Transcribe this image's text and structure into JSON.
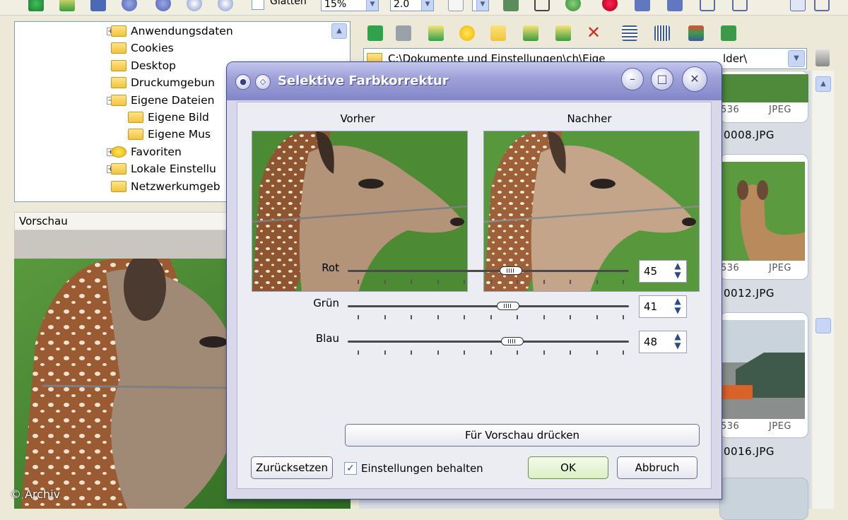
{
  "toolbar": {
    "smooth_label": "Glätten",
    "zoom_value": "15%",
    "gamma_value": "2.0"
  },
  "tree": {
    "items": [
      {
        "label": "Anwendungsdaten",
        "expander": "+"
      },
      {
        "label": "Cookies",
        "expander": ""
      },
      {
        "label": "Desktop",
        "expander": ""
      },
      {
        "label": "Druckumgebun",
        "expander": ""
      },
      {
        "label": "Eigene Dateien",
        "expander": "−"
      },
      {
        "label": "Eigene Bild",
        "expander": ""
      },
      {
        "label": "Eigene Mus",
        "expander": ""
      },
      {
        "label": "Favoriten",
        "expander": "+"
      },
      {
        "label": "Lokale Einstellu",
        "expander": "+"
      },
      {
        "label": "Netzwerkumgeb",
        "expander": ""
      }
    ]
  },
  "preview": {
    "header": "Vorschau"
  },
  "explorer": {
    "path": "C:\\Dokumente und Einstellungen\\ch\\Eige",
    "path_tail": "lder\\",
    "thumbs": [
      {
        "dims": "536",
        "type": "JPEG",
        "name": "0008.JPG"
      },
      {
        "dims": "536",
        "type": "JPEG",
        "name": "0012.JPG"
      },
      {
        "dims": "536",
        "type": "JPEG",
        "name": "0016.JPG"
      }
    ]
  },
  "dialog": {
    "title": "Selektive Farbkorrektur",
    "before_label": "Vorher",
    "after_label": "Nachher",
    "sliders": [
      {
        "label": "Rot",
        "value": "45",
        "fraction": 0.58
      },
      {
        "label": "Grün",
        "value": "41",
        "fraction": 0.57
      },
      {
        "label": "Blau",
        "value": "48",
        "fraction": 0.585
      }
    ],
    "preview_button": "Für Vorschau drücken",
    "reset_button": "Zurücksetzen",
    "keep_settings_label": "Einstellungen behalten",
    "keep_settings_checked": true,
    "ok_button": "OK",
    "cancel_button": "Abbruch"
  },
  "copyright": "© Archiv",
  "colors": {
    "dialog_title": "#8386c7",
    "accent_green": "#2fa24b",
    "cancel_red": "#d22c1a"
  }
}
